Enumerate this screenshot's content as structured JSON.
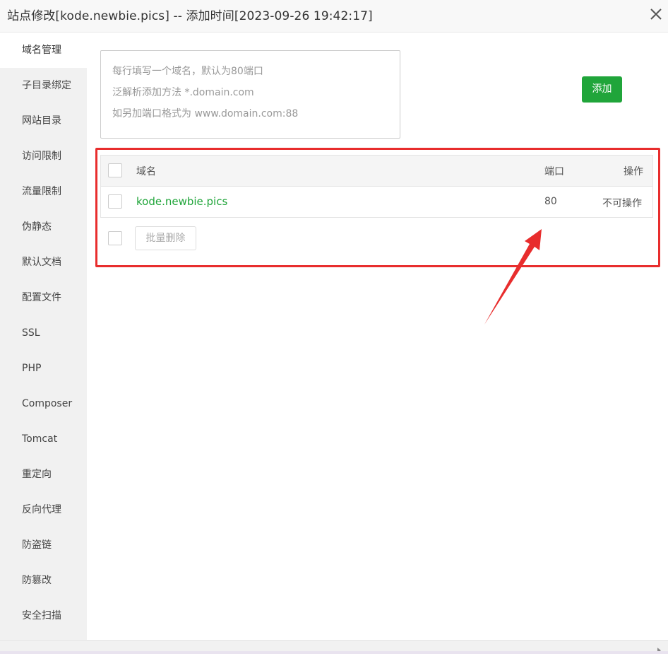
{
  "window": {
    "title": "站点修改[kode.newbie.pics] -- 添加时间[2023-09-26 19:42:17]",
    "close_icon": "close-icon"
  },
  "sidebar": {
    "active_index": 0,
    "items": [
      {
        "label": "域名管理"
      },
      {
        "label": "子目录绑定"
      },
      {
        "label": "网站目录"
      },
      {
        "label": "访问限制"
      },
      {
        "label": "流量限制"
      },
      {
        "label": "伪静态"
      },
      {
        "label": "默认文档"
      },
      {
        "label": "配置文件"
      },
      {
        "label": "SSL"
      },
      {
        "label": "PHP"
      },
      {
        "label": "Composer"
      },
      {
        "label": "Tomcat"
      },
      {
        "label": "重定向"
      },
      {
        "label": "反向代理"
      },
      {
        "label": "防盗链"
      },
      {
        "label": "防篡改"
      },
      {
        "label": "安全扫描"
      }
    ]
  },
  "domain_input": {
    "placeholder_lines": [
      "每行填写一个域名，默认为80端口",
      "泛解析添加方法 *.domain.com",
      "如另加端口格式为 www.domain.com:88"
    ],
    "value": ""
  },
  "add_button": {
    "label": "添加",
    "color": "#20a53a"
  },
  "table": {
    "headers": {
      "domain": "域名",
      "port": "端口",
      "action": "操作"
    },
    "rows": [
      {
        "domain": "kode.newbie.pics",
        "port": "80",
        "action": "不可操作"
      }
    ]
  },
  "batch": {
    "delete_label": "批量删除"
  },
  "annotation": {
    "color": "#e82d2d"
  }
}
